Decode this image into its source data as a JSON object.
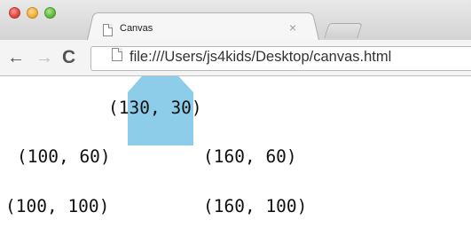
{
  "window": {
    "tab_title": "Canvas",
    "tab_close_glyph": "×",
    "url": "file:///Users/js4kids/Desktop/canvas.html"
  },
  "toolbar": {
    "back_glyph": "←",
    "forward_glyph": "→",
    "reload_glyph": "C"
  },
  "canvas": {
    "shape_color": "#8ecdea",
    "labels": {
      "top": "(130, 30)",
      "upper_left": "(100, 60)",
      "upper_right": "(160, 60)",
      "lower_left": "(100, 100)",
      "lower_right": "(160, 100)"
    }
  },
  "icons": {
    "close": "window-close-button",
    "minimize": "window-minimize-button",
    "maximize": "window-zoom-button",
    "page": "page-icon"
  }
}
